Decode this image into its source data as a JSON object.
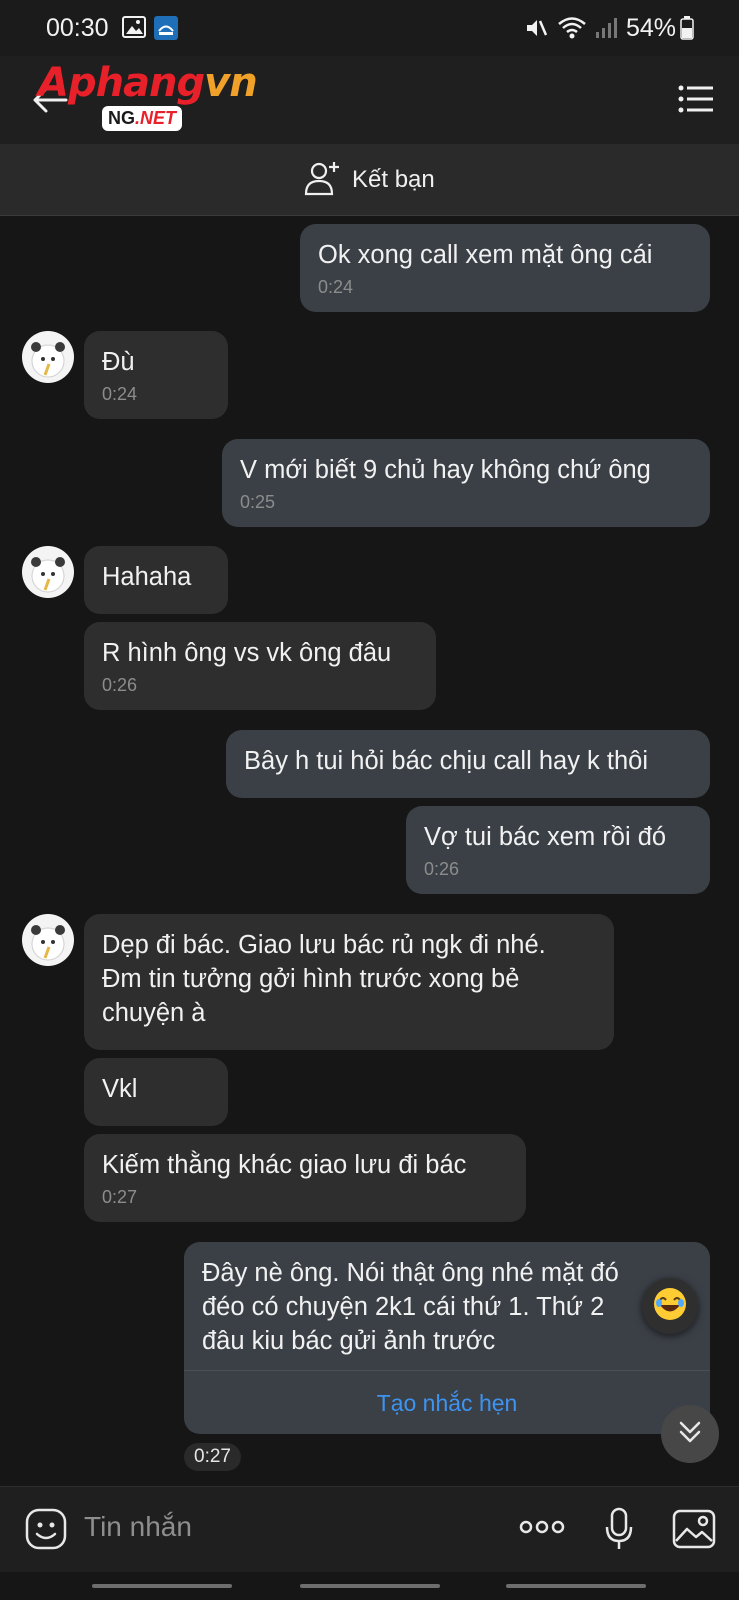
{
  "status_bar": {
    "time": "00:30",
    "battery": "54%"
  },
  "header": {
    "brand_main_a": "Aphang",
    "brand_main_b": "vn",
    "brand_sub_a": "NG",
    "brand_sub_b": ".NET",
    "add_friend_label": "Kết bạn"
  },
  "messages": [
    {
      "side": "out",
      "text": "Ok xong call xem mặt ông cái",
      "time": "0:24"
    },
    {
      "side": "in",
      "text": "Đù",
      "time": "0:24"
    },
    {
      "side": "out",
      "text": "V mới biết 9 chủ hay không chứ ông",
      "time": "0:25"
    },
    {
      "side": "in",
      "text": "Hahaha",
      "time": ""
    },
    {
      "side": "in",
      "text": "R hình ông vs vk ông đâu",
      "time": "0:26"
    },
    {
      "side": "out",
      "text": "Bây h tui hỏi bác chịu call hay k thôi",
      "time": ""
    },
    {
      "side": "out",
      "text": "Vợ tui bác xem rồi đó",
      "time": "0:26"
    },
    {
      "side": "in",
      "text": "Dẹp đi bác. Giao lưu bác rủ ngk đi nhé.\nĐm tin tưởng gởi hình trước xong bẻ\nchuyện à",
      "time": ""
    },
    {
      "side": "in",
      "text": "Vkl",
      "time": ""
    },
    {
      "side": "in",
      "text": "Kiếm thằng khác giao lưu đi bác",
      "time": "0:27"
    },
    {
      "side": "out",
      "text": "Đây nè ông. Nói thật ông nhé mặt đó\nđéo có chuyện 2k1 cái thứ 1. Thứ 2\nđâu kiu bác gửi ảnh trước",
      "time": ""
    }
  ],
  "reminder_label": "Tạo nhắc hẹn",
  "last_time": "0:27",
  "composer": {
    "placeholder": "Tin nhắn"
  },
  "colors": {
    "accent_link": "#3e93f0",
    "outgoing_bubble": "#3b4047",
    "incoming_bubble": "#2e2e2e"
  }
}
